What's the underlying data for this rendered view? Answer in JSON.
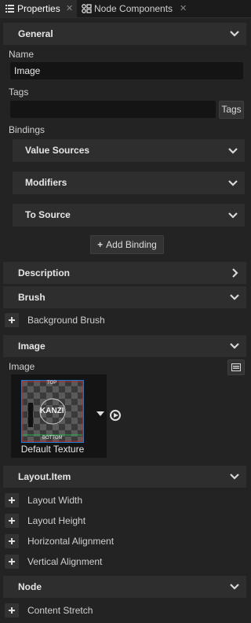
{
  "tabs": [
    {
      "label": "Properties",
      "icon": "list-icon",
      "active": true
    },
    {
      "label": "Node Components",
      "icon": "node-components-icon",
      "active": false
    }
  ],
  "sections": {
    "general": "General",
    "description": "Description",
    "brush": "Brush",
    "image": "Image",
    "layout_item": "Layout.Item",
    "node": "Node"
  },
  "general": {
    "name_label": "Name",
    "name_value": "Image",
    "tags_label": "Tags",
    "tags_value": "",
    "tags_button": "Tags",
    "bindings_label": "Bindings",
    "bindings_groups": [
      "Value Sources",
      "Modifiers",
      "To Source"
    ],
    "add_binding": "Add Binding"
  },
  "brush": {
    "properties": [
      "Background Brush"
    ]
  },
  "image": {
    "label": "Image",
    "texture_name": "Default Texture",
    "thumb_text": {
      "top": "TOP",
      "bottom": "BOTTOM",
      "logo": "KANZI"
    }
  },
  "layout_item": {
    "properties": [
      "Layout Width",
      "Layout Height",
      "Horizontal Alignment",
      "Vertical Alignment"
    ]
  },
  "node": {
    "properties": [
      "Content Stretch"
    ]
  },
  "colors": {
    "background": "#232323",
    "section": "#2e2e2e",
    "input": "#141414",
    "text": "#d6d6d6"
  }
}
